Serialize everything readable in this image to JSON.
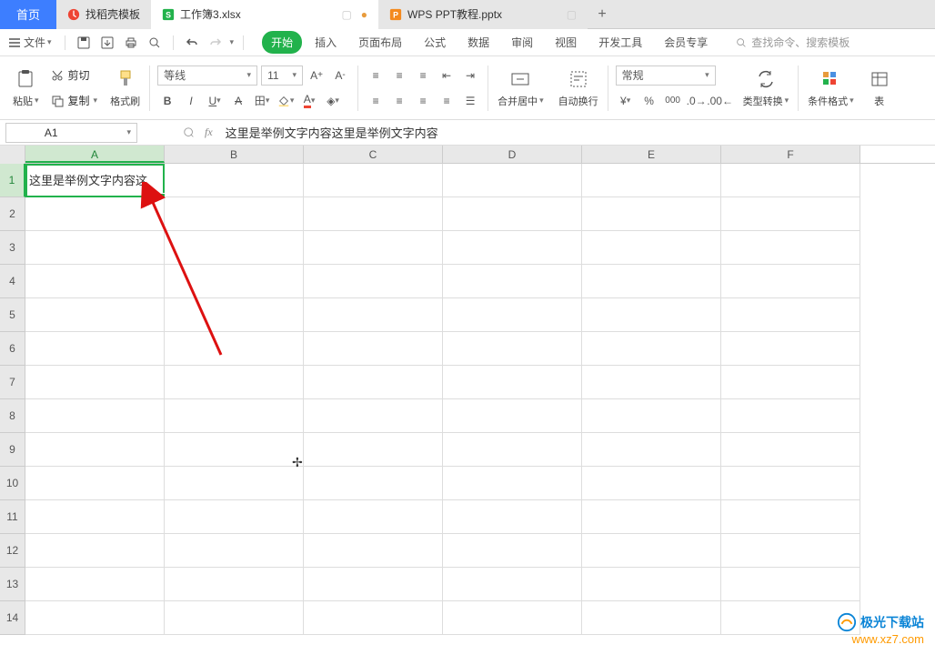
{
  "tabs": {
    "home": "首页",
    "t1": "找稻壳模板",
    "t2": "工作簿3.xlsx",
    "t3": "WPS PPT教程.pptx"
  },
  "menus": {
    "file": "文件",
    "start": "开始",
    "insert": "插入",
    "layout": "页面布局",
    "formulas": "公式",
    "data": "数据",
    "review": "审阅",
    "view": "视图",
    "dev": "开发工具",
    "vip": "会员专享",
    "search": "查找命令、搜索模板"
  },
  "ribbon": {
    "cut": "剪切",
    "copy": "复制",
    "paste": "粘贴",
    "fmtpainter": "格式刷",
    "font": "等线",
    "fontsize": "11",
    "merge": "合并居中",
    "wrap": "自动换行",
    "numfmt": "常规",
    "typeconv": "类型转换",
    "condfmt": "条件格式",
    "table": "表"
  },
  "namebox": "A1",
  "formula": "这里是举例文字内容这里是举例文字内容",
  "columns": [
    "A",
    "B",
    "C",
    "D",
    "E",
    "F"
  ],
  "rows": [
    "1",
    "2",
    "3",
    "4",
    "5",
    "6",
    "7",
    "8",
    "9",
    "10",
    "11",
    "12",
    "13",
    "14"
  ],
  "cellA1": "这里是举例文字内容这",
  "watermark": {
    "site": "极光下载站",
    "url": "www.xz7.com"
  }
}
